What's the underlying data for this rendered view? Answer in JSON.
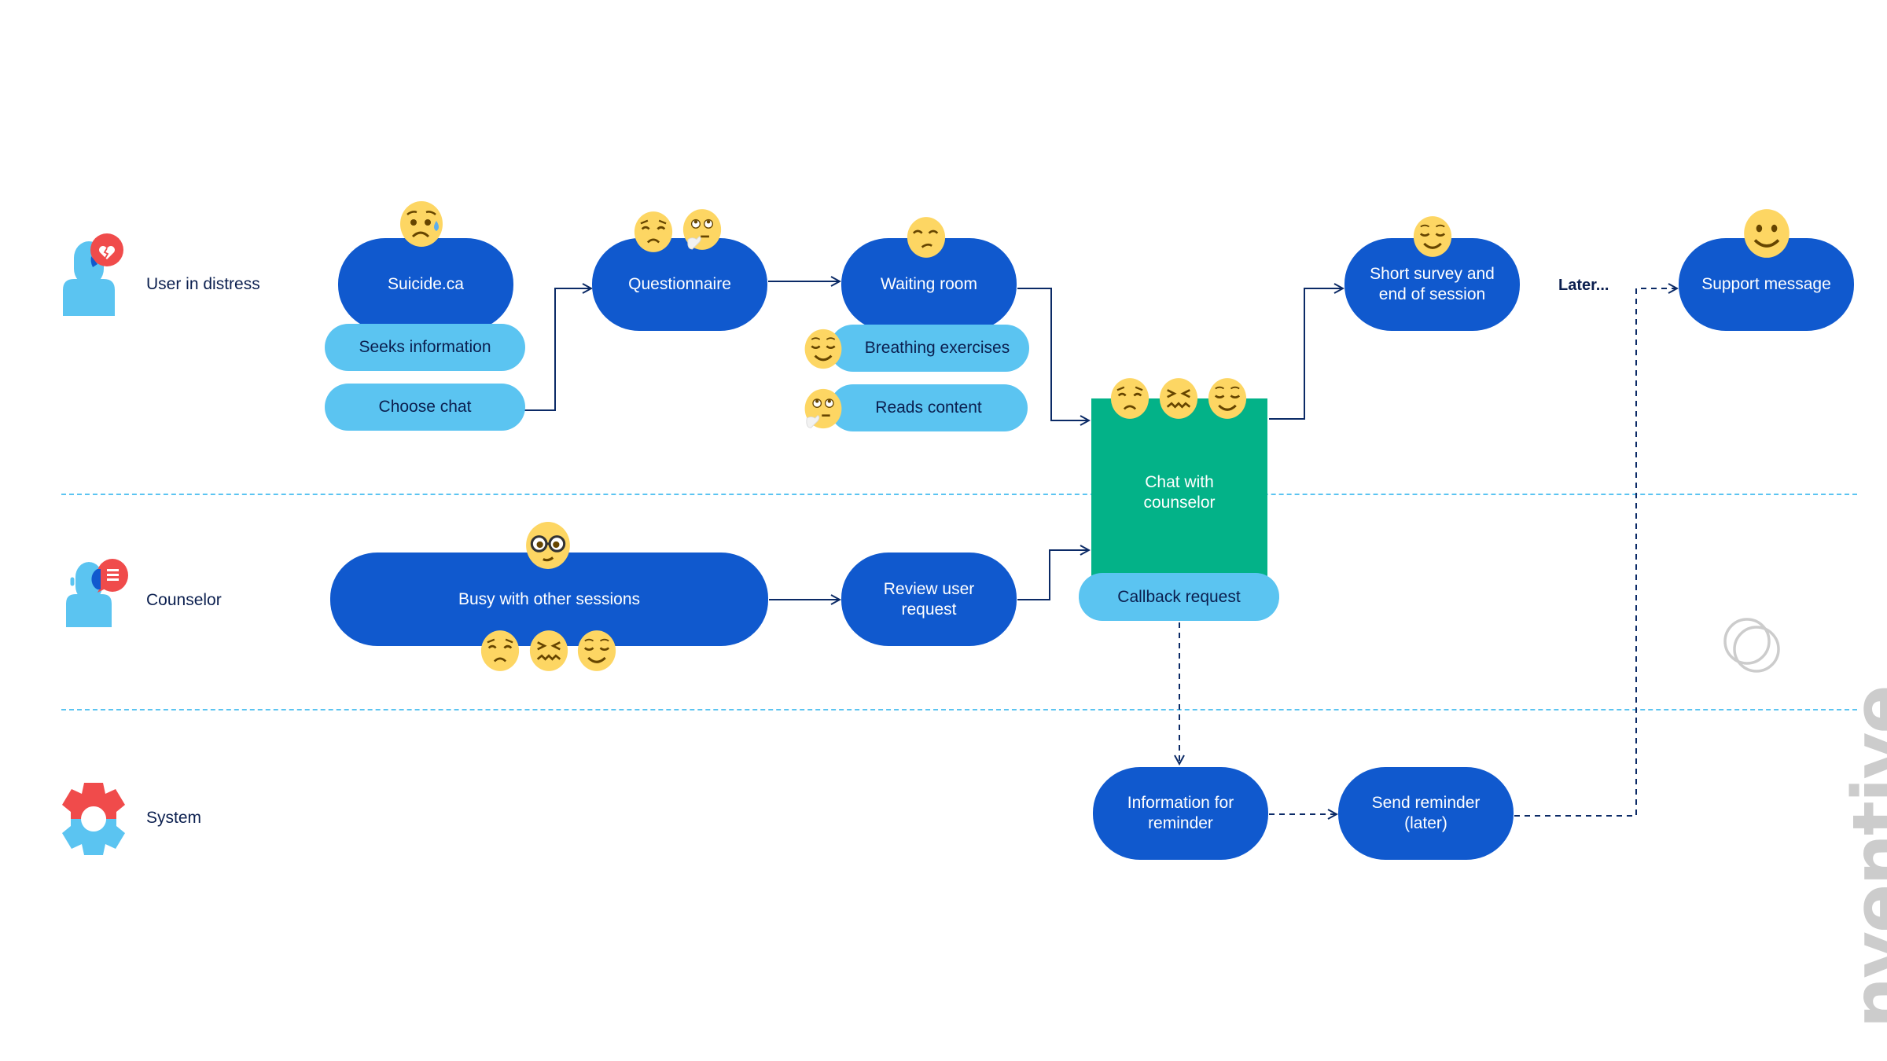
{
  "lanes": [
    {
      "label": "User in distress",
      "icon": "user-broken-heart-icon"
    },
    {
      "label": "Counselor",
      "icon": "counselor-headset-icon"
    },
    {
      "label": "System",
      "icon": "gear-icon"
    }
  ],
  "user_lane": {
    "suicide_ca": {
      "label": "Suicide.ca",
      "emoji": [
        "sad-sweat-face"
      ]
    },
    "seeks_information": {
      "label": "Seeks information"
    },
    "choose_chat": {
      "label": "Choose chat"
    },
    "questionnaire": {
      "label": "Questionnaire",
      "emoji": [
        "pensive-face",
        "thinking-face"
      ]
    },
    "waiting_room": {
      "label": "Waiting room",
      "emoji": [
        "unamused-face"
      ]
    },
    "breathing_exercises": {
      "label": "Breathing exercises",
      "emoji": [
        "relieved-face"
      ]
    },
    "reads_content": {
      "label": "Reads content",
      "emoji": [
        "thinking-face"
      ]
    },
    "short_survey": {
      "label": "Short survey and end of session",
      "emoji": [
        "relieved-face"
      ]
    },
    "later_text": "Later...",
    "support_message": {
      "label": "Support message",
      "emoji": [
        "smiling-face"
      ]
    }
  },
  "shared": {
    "chat_with_counselor": {
      "label": "Chat with counselor",
      "emoji": [
        "pensive-face",
        "confounded-face",
        "relieved-face"
      ]
    },
    "callback_request": {
      "label": "Callback request"
    }
  },
  "counselor_lane": {
    "busy": {
      "label": "Busy with other sessions",
      "emoji_top": [
        "nerd-glasses-face"
      ],
      "emoji_bottom": [
        "pensive-face",
        "confounded-face",
        "relieved-face"
      ]
    },
    "review_request": {
      "label": "Review user request"
    }
  },
  "system_lane": {
    "info_reminder": {
      "label": "Information for reminder"
    },
    "send_reminder": {
      "label": "Send reminder (later)"
    }
  },
  "brand": {
    "logo_text": "nventive"
  },
  "colors": {
    "node_dark_blue": "#1059ce",
    "pill_light_blue": "#5bc4f1",
    "chat_green": "#03b288",
    "text_navy": "#0b1f4f",
    "icon_red": "#f04b4b",
    "emoji_yellow": "#fdd663",
    "logo_gray": "#cccccc"
  }
}
